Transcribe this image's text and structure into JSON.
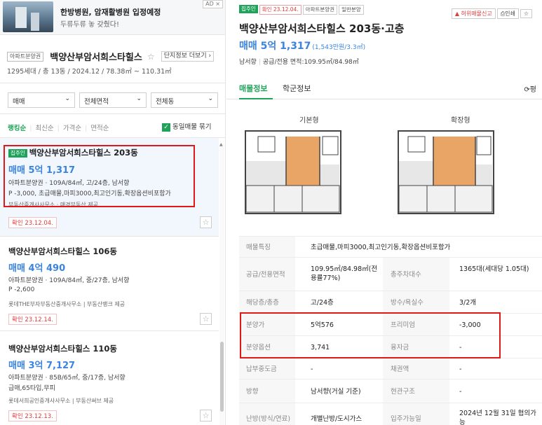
{
  "ad": {
    "tag": "AD ×",
    "title": "한방병원, 암재활병원 입정예정",
    "subtitle": "두류두류 놓 갖췄다!"
  },
  "complex": {
    "type_tag": "아파트분양권",
    "name": "백양산부암서희스타힐스",
    "info_link": "단지정보 더보기 ›",
    "meta": "1295세대 / 총 13동 / 2024.12 / 78.38㎡ ~ 110.31㎡"
  },
  "filters": {
    "trade": "매매",
    "area": "전체면적",
    "dong": "전체동"
  },
  "sort": {
    "options": [
      "랭킹순",
      "최신순",
      "가격순",
      "면적순"
    ],
    "same_listing": "동일매물 묶기"
  },
  "listings": [
    {
      "confirm_tag": "집주인",
      "title": "백양산부암서희스타힐스 203동",
      "price": "매매 5억 1,317",
      "spec": "아파트분양권 · 109A/84㎡, 고/24층, 남서향",
      "desc": "P -3,000, 초급매물,마피3000,최고인기동,확장옵션비포함가",
      "agent": "부동산중개사사무소 · 매경부동산 제공",
      "date": "확인 23.12.04."
    },
    {
      "title": "백양산부암서희스타힐스 106동",
      "price": "매매 4억 490",
      "spec": "아파트분양권 · 109A/84㎡, 중/27층, 남서향",
      "desc": "P -2,600",
      "agent": "롯데THE부자부동산중개사무소 | 부동산뱅크 제공",
      "date": "확인 23.12.14."
    },
    {
      "title": "백양산부암서희스타힐스 110동",
      "price": "매매 3억 7,127",
      "spec": "아파트분양권 · 85B/65㎡, 중/17층, 남서향",
      "desc": "급매,65타입,무피",
      "agent": "롯데서희공인중개사사무소 | 부동산써브 제공",
      "date": "확인 23.12.13."
    }
  ],
  "detail": {
    "badges": [
      "집주인",
      "확인 23.12.04.",
      "아파트분양권",
      "일반분양"
    ],
    "report_btn": "허위매물신고",
    "print_btn": "인쇄",
    "title": "백양산부암서희스타힐스 203동·고층",
    "price": "매매 5억 1,317",
    "price_sub": "(1,543만원/3.3㎡)",
    "direction": "남서향",
    "area": "공급/전용 면적:109.95㎡/84.98㎡",
    "tabs": [
      "매물정보",
      "학군정보"
    ],
    "refresh": "평",
    "floorplans": [
      "기본형",
      "확장형"
    ],
    "rows": [
      {
        "l1": "매물특징",
        "v1": "초급매물,마피3000,최고인기동,확장옵션비포함가"
      },
      {
        "l1": "공급/전용면적",
        "v1": "109.95㎡/84.98㎡(전용률77%)",
        "l2": "총주차대수",
        "v2": "1365대(세대당 1.05대)"
      },
      {
        "l1": "해당층/총층",
        "v1": "고/24층",
        "l2": "방수/욕실수",
        "v2": "3/2개"
      },
      {
        "l1": "분양가",
        "v1": "5억576",
        "l2": "프리미엄",
        "v2": "-3,000"
      },
      {
        "l1": "분양옵션",
        "v1": "3,741",
        "l2": "융자금",
        "v2": "-"
      },
      {
        "l1": "납부중도금",
        "v1": "-",
        "l2": "채권액",
        "v2": "-"
      },
      {
        "l1": "방향",
        "v1": "남서향(거실 기준)",
        "l2": "현관구조",
        "v2": "-"
      },
      {
        "l1": "난방(방식/연료)",
        "v1": "개별난방/도시가스",
        "l2": "입주가능일",
        "v2": "2024년 12월 31일 협의가능"
      }
    ]
  }
}
